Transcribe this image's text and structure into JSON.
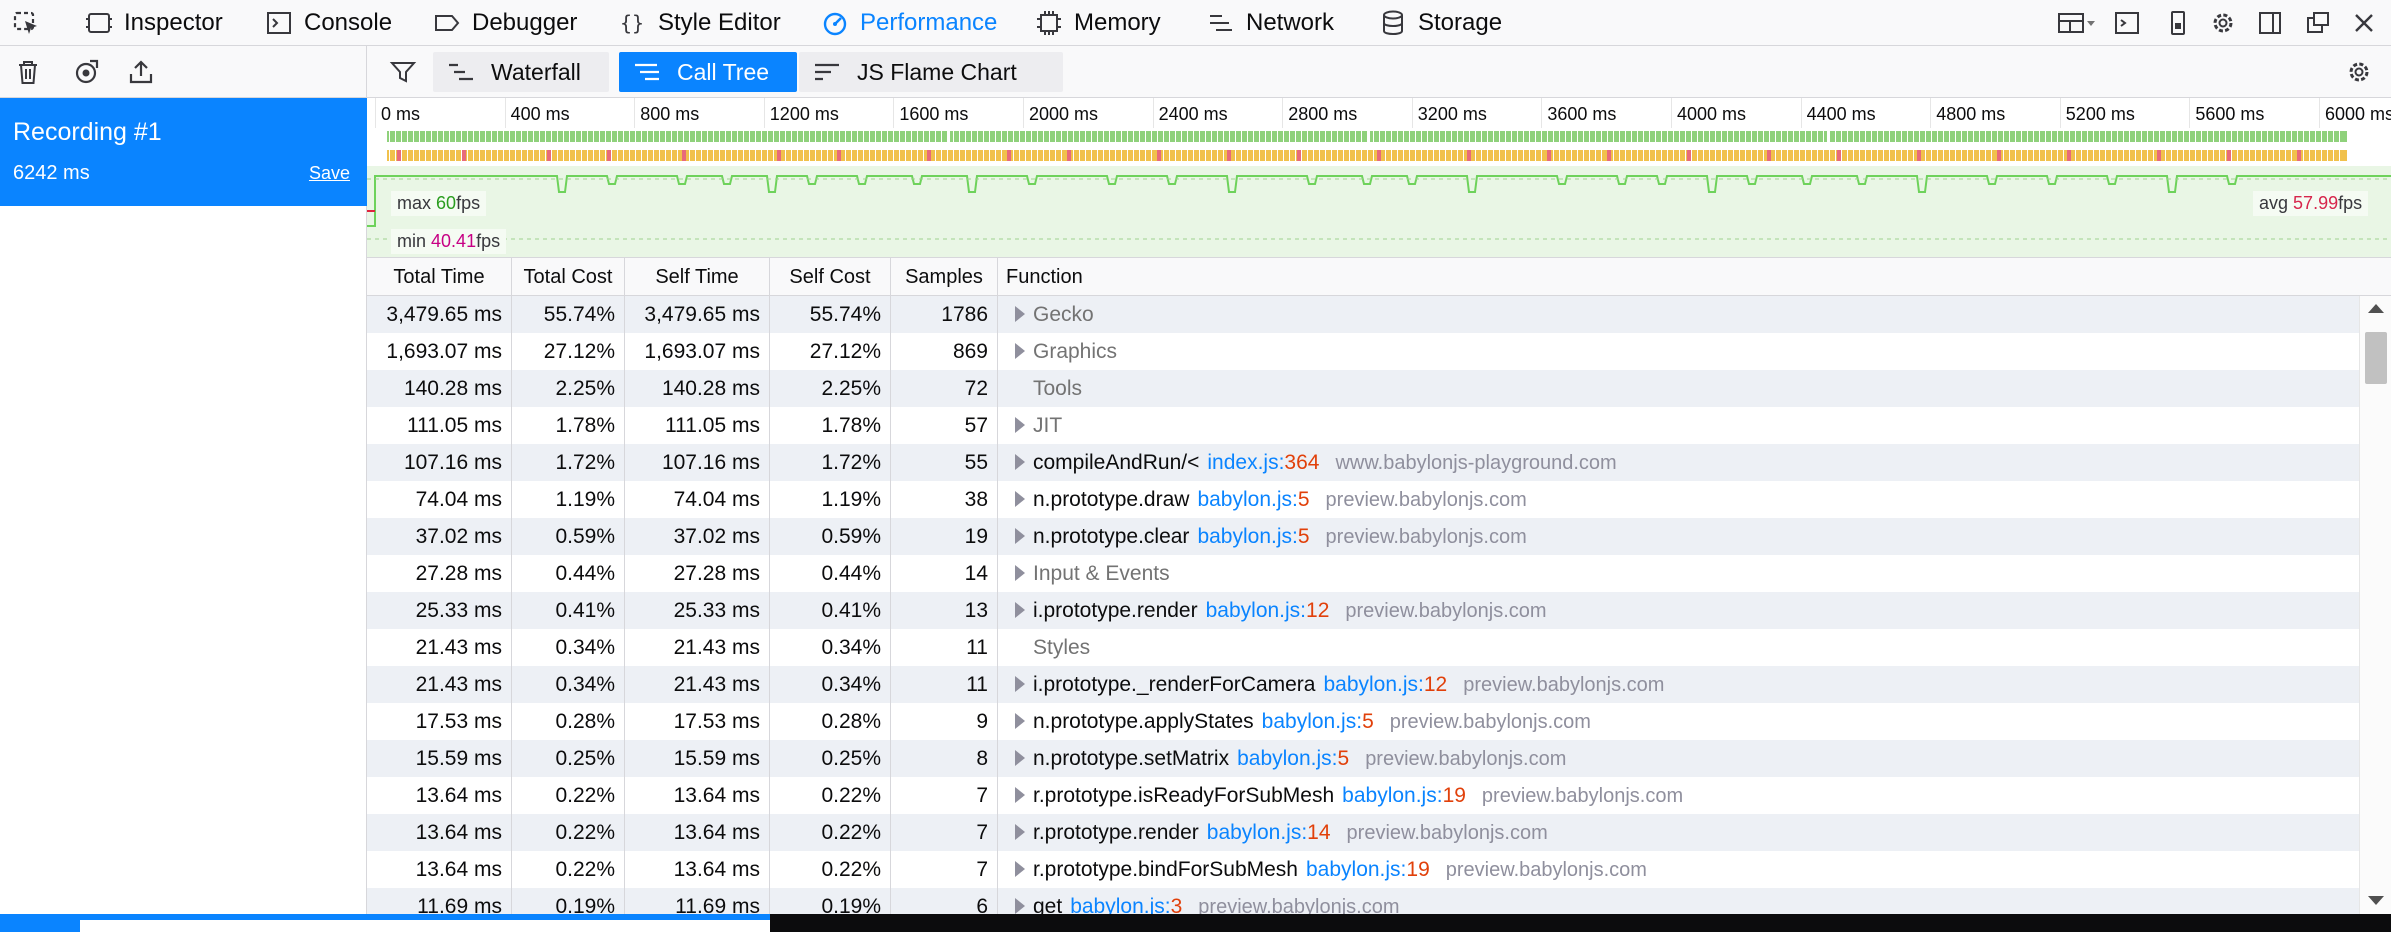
{
  "toolbar": {
    "tabs": [
      {
        "label": "Inspector",
        "icon": "inspector-icon"
      },
      {
        "label": "Console",
        "icon": "console-icon"
      },
      {
        "label": "Debugger",
        "icon": "debugger-icon"
      },
      {
        "label": "Style Editor",
        "icon": "style-editor-icon"
      },
      {
        "label": "Performance",
        "icon": "performance-icon",
        "active": true
      },
      {
        "label": "Memory",
        "icon": "memory-icon"
      },
      {
        "label": "Network",
        "icon": "network-icon"
      },
      {
        "label": "Storage",
        "icon": "storage-icon"
      }
    ]
  },
  "sidebar": {
    "recording_name": "Recording #1",
    "recording_duration": "6242 ms",
    "save_label": "Save"
  },
  "views": {
    "tabs": [
      {
        "label": "Waterfall",
        "icon": "waterfall-icon"
      },
      {
        "label": "Call Tree",
        "icon": "call-tree-icon",
        "active": true
      },
      {
        "label": "JS Flame Chart",
        "icon": "flame-chart-icon"
      }
    ]
  },
  "timeline": {
    "ticks": [
      "0 ms",
      "400 ms",
      "800 ms",
      "1200 ms",
      "1600 ms",
      "2000 ms",
      "2400 ms",
      "2800 ms",
      "3200 ms",
      "3600 ms",
      "4000 ms",
      "4400 ms",
      "4800 ms",
      "5200 ms",
      "5600 ms",
      "6000 ms"
    ],
    "fps": {
      "max_label": "max",
      "max_value": "60",
      "min_label": "min",
      "min_value": "40.41",
      "avg_label": "avg",
      "avg_value": "57.99",
      "unit": "fps"
    }
  },
  "calltree": {
    "columns": [
      "Total Time",
      "Total Cost",
      "Self Time",
      "Self Cost",
      "Samples",
      "Function"
    ],
    "rows": [
      {
        "total_time": "3,479.65 ms",
        "total_cost": "55.74%",
        "self_time": "3,479.65 ms",
        "self_cost": "55.74%",
        "samples": "1786",
        "function": "Gecko",
        "category": true,
        "expandable": true,
        "file": "",
        "line": "",
        "host": ""
      },
      {
        "total_time": "1,693.07 ms",
        "total_cost": "27.12%",
        "self_time": "1,693.07 ms",
        "self_cost": "27.12%",
        "samples": "869",
        "function": "Graphics",
        "category": true,
        "expandable": true,
        "file": "",
        "line": "",
        "host": ""
      },
      {
        "total_time": "140.28 ms",
        "total_cost": "2.25%",
        "self_time": "140.28 ms",
        "self_cost": "2.25%",
        "samples": "72",
        "function": "Tools",
        "category": true,
        "expandable": false,
        "file": "",
        "line": "",
        "host": ""
      },
      {
        "total_time": "111.05 ms",
        "total_cost": "1.78%",
        "self_time": "111.05 ms",
        "self_cost": "1.78%",
        "samples": "57",
        "function": "JIT",
        "category": true,
        "expandable": true,
        "file": "",
        "line": "",
        "host": ""
      },
      {
        "total_time": "107.16 ms",
        "total_cost": "1.72%",
        "self_time": "107.16 ms",
        "self_cost": "1.72%",
        "samples": "55",
        "function": "compileAndRun/<",
        "category": false,
        "expandable": true,
        "file": "index.js",
        "line": "364",
        "host": "www.babylonjs-playground.com"
      },
      {
        "total_time": "74.04 ms",
        "total_cost": "1.19%",
        "self_time": "74.04 ms",
        "self_cost": "1.19%",
        "samples": "38",
        "function": "n.prototype.draw",
        "category": false,
        "expandable": true,
        "file": "babylon.js",
        "line": "5",
        "host": "preview.babylonjs.com"
      },
      {
        "total_time": "37.02 ms",
        "total_cost": "0.59%",
        "self_time": "37.02 ms",
        "self_cost": "0.59%",
        "samples": "19",
        "function": "n.prototype.clear",
        "category": false,
        "expandable": true,
        "file": "babylon.js",
        "line": "5",
        "host": "preview.babylonjs.com"
      },
      {
        "total_time": "27.28 ms",
        "total_cost": "0.44%",
        "self_time": "27.28 ms",
        "self_cost": "0.44%",
        "samples": "14",
        "function": "Input & Events",
        "category": true,
        "expandable": true,
        "file": "",
        "line": "",
        "host": ""
      },
      {
        "total_time": "25.33 ms",
        "total_cost": "0.41%",
        "self_time": "25.33 ms",
        "self_cost": "0.41%",
        "samples": "13",
        "function": "i.prototype.render",
        "category": false,
        "expandable": true,
        "file": "babylon.js",
        "line": "12",
        "host": "preview.babylonjs.com"
      },
      {
        "total_time": "21.43 ms",
        "total_cost": "0.34%",
        "self_time": "21.43 ms",
        "self_cost": "0.34%",
        "samples": "11",
        "function": "Styles",
        "category": true,
        "expandable": false,
        "file": "",
        "line": "",
        "host": ""
      },
      {
        "total_time": "21.43 ms",
        "total_cost": "0.34%",
        "self_time": "21.43 ms",
        "self_cost": "0.34%",
        "samples": "11",
        "function": "i.prototype._renderForCamera",
        "category": false,
        "expandable": true,
        "file": "babylon.js",
        "line": "12",
        "host": "preview.babylonjs.com"
      },
      {
        "total_time": "17.53 ms",
        "total_cost": "0.28%",
        "self_time": "17.53 ms",
        "self_cost": "0.28%",
        "samples": "9",
        "function": "n.prototype.applyStates",
        "category": false,
        "expandable": true,
        "file": "babylon.js",
        "line": "5",
        "host": "preview.babylonjs.com"
      },
      {
        "total_time": "15.59 ms",
        "total_cost": "0.25%",
        "self_time": "15.59 ms",
        "self_cost": "0.25%",
        "samples": "8",
        "function": "n.prototype.setMatrix",
        "category": false,
        "expandable": true,
        "file": "babylon.js",
        "line": "5",
        "host": "preview.babylonjs.com"
      },
      {
        "total_time": "13.64 ms",
        "total_cost": "0.22%",
        "self_time": "13.64 ms",
        "self_cost": "0.22%",
        "samples": "7",
        "function": "r.prototype.isReadyForSubMesh",
        "category": false,
        "expandable": true,
        "file": "babylon.js",
        "line": "19",
        "host": "preview.babylonjs.com"
      },
      {
        "total_time": "13.64 ms",
        "total_cost": "0.22%",
        "self_time": "13.64 ms",
        "self_cost": "0.22%",
        "samples": "7",
        "function": "r.prototype.render",
        "category": false,
        "expandable": true,
        "file": "babylon.js",
        "line": "14",
        "host": "preview.babylonjs.com"
      },
      {
        "total_time": "13.64 ms",
        "total_cost": "0.22%",
        "self_time": "13.64 ms",
        "self_cost": "0.22%",
        "samples": "7",
        "function": "r.prototype.bindForSubMesh",
        "category": false,
        "expandable": true,
        "file": "babylon.js",
        "line": "19",
        "host": "preview.babylonjs.com"
      },
      {
        "total_time": "11.69 ms",
        "total_cost": "0.19%",
        "self_time": "11.69 ms",
        "self_cost": "0.19%",
        "samples": "6",
        "function": "get",
        "category": false,
        "expandable": true,
        "file": "babylon.js",
        "line": "3",
        "host": "preview.babylonjs.com"
      }
    ]
  },
  "colors": {
    "accent": "#0a84ff",
    "fps_line": "#6ed25b",
    "marker_green": "#8fd17b",
    "marker_orange": "#f1c14c",
    "marker_red": "#e86a7a",
    "line_number": "#e1400a"
  }
}
